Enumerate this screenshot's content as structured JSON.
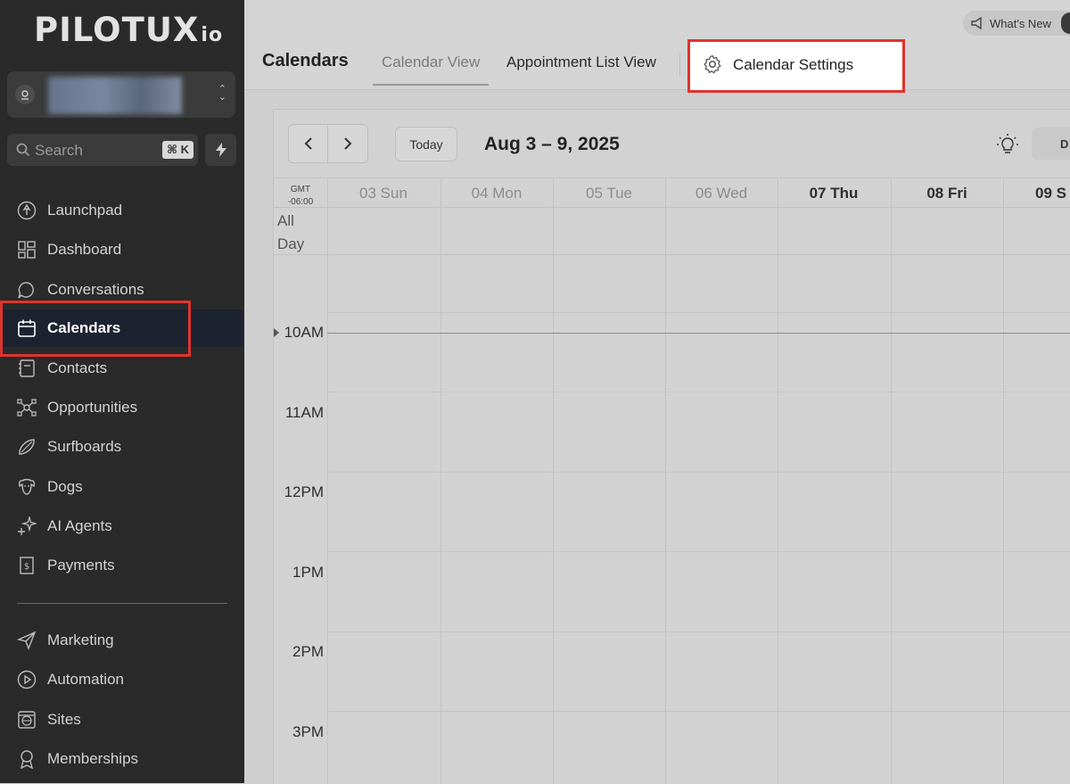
{
  "sidebar": {
    "logo_text": "PILOTUX",
    "logo_suffix": "io",
    "search": {
      "placeholder": "Search",
      "shortcut": "⌘ K"
    },
    "items": [
      {
        "label": "Launchpad",
        "icon": "rocket-icon"
      },
      {
        "label": "Dashboard",
        "icon": "grid-icon"
      },
      {
        "label": "Conversations",
        "icon": "chat-bubble-icon"
      },
      {
        "label": "Calendars",
        "icon": "calendar-icon",
        "active": true
      },
      {
        "label": "Contacts",
        "icon": "address-book-icon"
      },
      {
        "label": "Opportunities",
        "icon": "network-icon"
      },
      {
        "label": "Surfboards",
        "icon": "surfboard-icon"
      },
      {
        "label": "Dogs",
        "icon": "dog-icon"
      },
      {
        "label": "AI Agents",
        "icon": "sparkle-icon"
      },
      {
        "label": "Payments",
        "icon": "dollar-document-icon"
      }
    ],
    "items2": [
      {
        "label": "Marketing",
        "icon": "paper-plane-icon"
      },
      {
        "label": "Automation",
        "icon": "play-circle-icon"
      },
      {
        "label": "Sites",
        "icon": "globe-icon"
      },
      {
        "label": "Memberships",
        "icon": "award-icon"
      }
    ]
  },
  "header": {
    "title": "Calendars",
    "tabs": [
      "Calendar View",
      "Appointment List View",
      "Calendar Settings"
    ],
    "whats_new": "What's New"
  },
  "calendar": {
    "today_label": "Today",
    "range": "Aug 3 – 9, 2025",
    "view_stub": "D",
    "tz_line1": "GMT",
    "tz_line2": "-06:00",
    "all_day_1": "All",
    "all_day_2": "Day",
    "days": [
      "03 Sun",
      "04 Mon",
      "05 Tue",
      "06 Wed",
      "07 Thu",
      "08 Fri",
      "09 S"
    ],
    "times": [
      "10AM",
      "11AM",
      "12PM",
      "1PM",
      "2PM",
      "3PM"
    ]
  },
  "colors": {
    "sidebar_bg": "#2a2a2a",
    "active_bg": "#1d2231",
    "highlight": "#e0332e"
  }
}
